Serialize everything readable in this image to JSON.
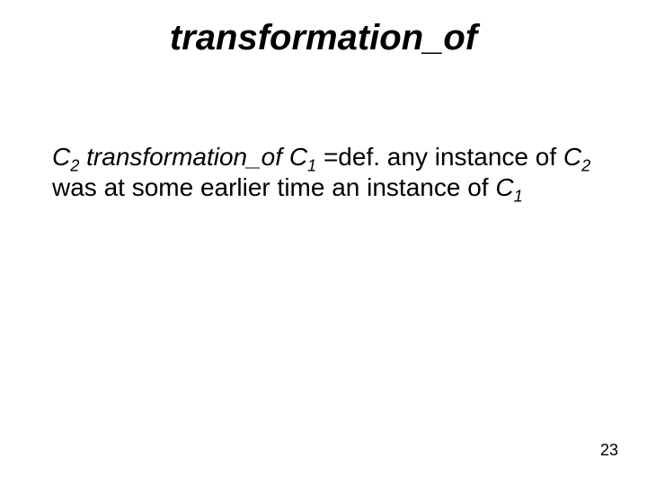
{
  "title": "transformation_of",
  "body": {
    "c": "C",
    "sub2": "2",
    "sub1": "1",
    "relation": " transformation_of ",
    "eqdef": " =def.",
    "seg_any_instance_of": " any instance of ",
    "seg_was_at_some": " was at some earlier time an instance of "
  },
  "page_number": "23"
}
